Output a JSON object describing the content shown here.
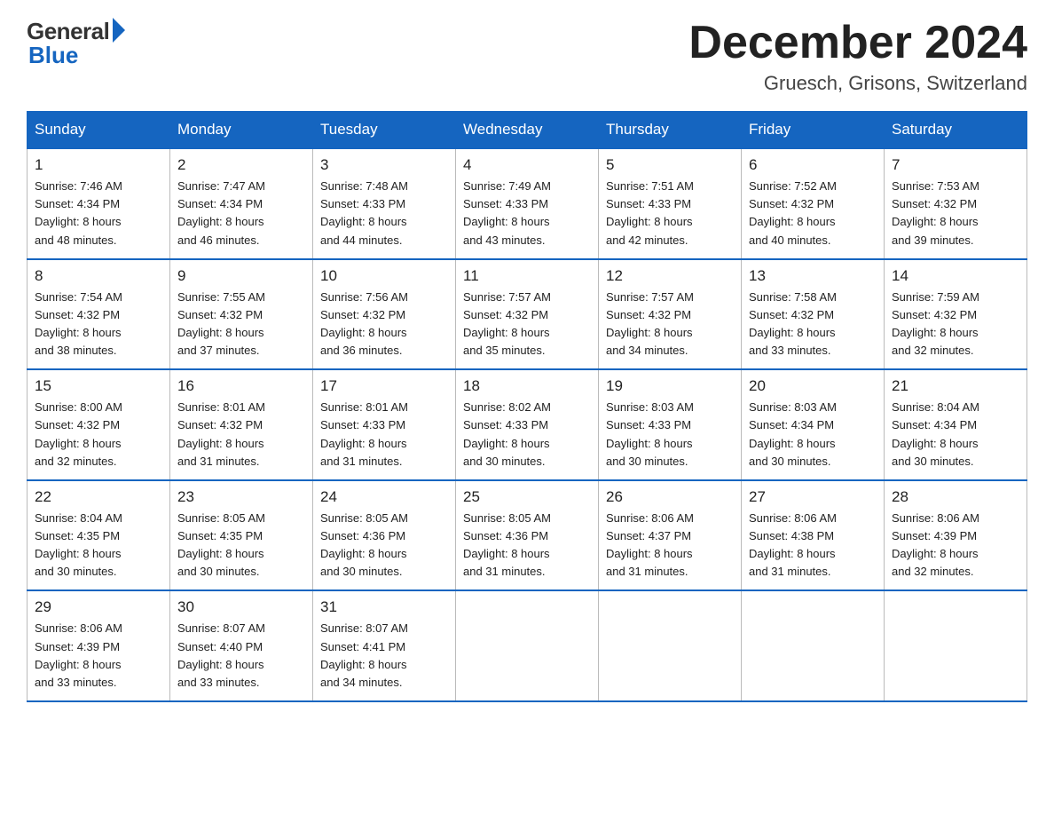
{
  "logo": {
    "general": "General",
    "blue": "Blue"
  },
  "title": "December 2024",
  "location": "Gruesch, Grisons, Switzerland",
  "days_of_week": [
    "Sunday",
    "Monday",
    "Tuesday",
    "Wednesday",
    "Thursday",
    "Friday",
    "Saturday"
  ],
  "weeks": [
    [
      {
        "day": "1",
        "sunrise": "7:46 AM",
        "sunset": "4:34 PM",
        "daylight": "8 hours and 48 minutes."
      },
      {
        "day": "2",
        "sunrise": "7:47 AM",
        "sunset": "4:34 PM",
        "daylight": "8 hours and 46 minutes."
      },
      {
        "day": "3",
        "sunrise": "7:48 AM",
        "sunset": "4:33 PM",
        "daylight": "8 hours and 44 minutes."
      },
      {
        "day": "4",
        "sunrise": "7:49 AM",
        "sunset": "4:33 PM",
        "daylight": "8 hours and 43 minutes."
      },
      {
        "day": "5",
        "sunrise": "7:51 AM",
        "sunset": "4:33 PM",
        "daylight": "8 hours and 42 minutes."
      },
      {
        "day": "6",
        "sunrise": "7:52 AM",
        "sunset": "4:32 PM",
        "daylight": "8 hours and 40 minutes."
      },
      {
        "day": "7",
        "sunrise": "7:53 AM",
        "sunset": "4:32 PM",
        "daylight": "8 hours and 39 minutes."
      }
    ],
    [
      {
        "day": "8",
        "sunrise": "7:54 AM",
        "sunset": "4:32 PM",
        "daylight": "8 hours and 38 minutes."
      },
      {
        "day": "9",
        "sunrise": "7:55 AM",
        "sunset": "4:32 PM",
        "daylight": "8 hours and 37 minutes."
      },
      {
        "day": "10",
        "sunrise": "7:56 AM",
        "sunset": "4:32 PM",
        "daylight": "8 hours and 36 minutes."
      },
      {
        "day": "11",
        "sunrise": "7:57 AM",
        "sunset": "4:32 PM",
        "daylight": "8 hours and 35 minutes."
      },
      {
        "day": "12",
        "sunrise": "7:57 AM",
        "sunset": "4:32 PM",
        "daylight": "8 hours and 34 minutes."
      },
      {
        "day": "13",
        "sunrise": "7:58 AM",
        "sunset": "4:32 PM",
        "daylight": "8 hours and 33 minutes."
      },
      {
        "day": "14",
        "sunrise": "7:59 AM",
        "sunset": "4:32 PM",
        "daylight": "8 hours and 32 minutes."
      }
    ],
    [
      {
        "day": "15",
        "sunrise": "8:00 AM",
        "sunset": "4:32 PM",
        "daylight": "8 hours and 32 minutes."
      },
      {
        "day": "16",
        "sunrise": "8:01 AM",
        "sunset": "4:32 PM",
        "daylight": "8 hours and 31 minutes."
      },
      {
        "day": "17",
        "sunrise": "8:01 AM",
        "sunset": "4:33 PM",
        "daylight": "8 hours and 31 minutes."
      },
      {
        "day": "18",
        "sunrise": "8:02 AM",
        "sunset": "4:33 PM",
        "daylight": "8 hours and 30 minutes."
      },
      {
        "day": "19",
        "sunrise": "8:03 AM",
        "sunset": "4:33 PM",
        "daylight": "8 hours and 30 minutes."
      },
      {
        "day": "20",
        "sunrise": "8:03 AM",
        "sunset": "4:34 PM",
        "daylight": "8 hours and 30 minutes."
      },
      {
        "day": "21",
        "sunrise": "8:04 AM",
        "sunset": "4:34 PM",
        "daylight": "8 hours and 30 minutes."
      }
    ],
    [
      {
        "day": "22",
        "sunrise": "8:04 AM",
        "sunset": "4:35 PM",
        "daylight": "8 hours and 30 minutes."
      },
      {
        "day": "23",
        "sunrise": "8:05 AM",
        "sunset": "4:35 PM",
        "daylight": "8 hours and 30 minutes."
      },
      {
        "day": "24",
        "sunrise": "8:05 AM",
        "sunset": "4:36 PM",
        "daylight": "8 hours and 30 minutes."
      },
      {
        "day": "25",
        "sunrise": "8:05 AM",
        "sunset": "4:36 PM",
        "daylight": "8 hours and 31 minutes."
      },
      {
        "day": "26",
        "sunrise": "8:06 AM",
        "sunset": "4:37 PM",
        "daylight": "8 hours and 31 minutes."
      },
      {
        "day": "27",
        "sunrise": "8:06 AM",
        "sunset": "4:38 PM",
        "daylight": "8 hours and 31 minutes."
      },
      {
        "day": "28",
        "sunrise": "8:06 AM",
        "sunset": "4:39 PM",
        "daylight": "8 hours and 32 minutes."
      }
    ],
    [
      {
        "day": "29",
        "sunrise": "8:06 AM",
        "sunset": "4:39 PM",
        "daylight": "8 hours and 33 minutes."
      },
      {
        "day": "30",
        "sunrise": "8:07 AM",
        "sunset": "4:40 PM",
        "daylight": "8 hours and 33 minutes."
      },
      {
        "day": "31",
        "sunrise": "8:07 AM",
        "sunset": "4:41 PM",
        "daylight": "8 hours and 34 minutes."
      },
      null,
      null,
      null,
      null
    ]
  ],
  "labels": {
    "sunrise": "Sunrise:",
    "sunset": "Sunset:",
    "daylight": "Daylight:"
  }
}
